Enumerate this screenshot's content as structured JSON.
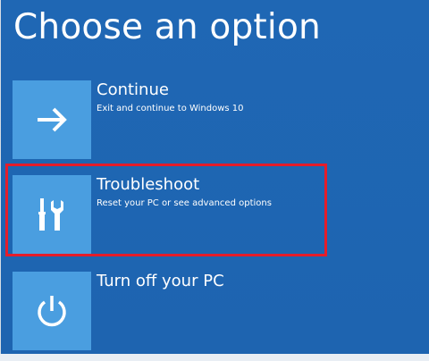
{
  "page": {
    "title": "Choose an option"
  },
  "options": [
    {
      "label": "Continue",
      "description": "Exit and continue to Windows 10",
      "icon": "arrow-right-icon"
    },
    {
      "label": "Troubleshoot",
      "description": "Reset your PC or see advanced options",
      "icon": "screwdriver-wrench-icon"
    },
    {
      "label": "Turn off your PC",
      "description": "",
      "icon": "power-icon"
    }
  ],
  "colors": {
    "background": "#1f66b3",
    "tile": "#4a9ee0",
    "highlight": "#e51d2a",
    "text": "#ffffff"
  }
}
